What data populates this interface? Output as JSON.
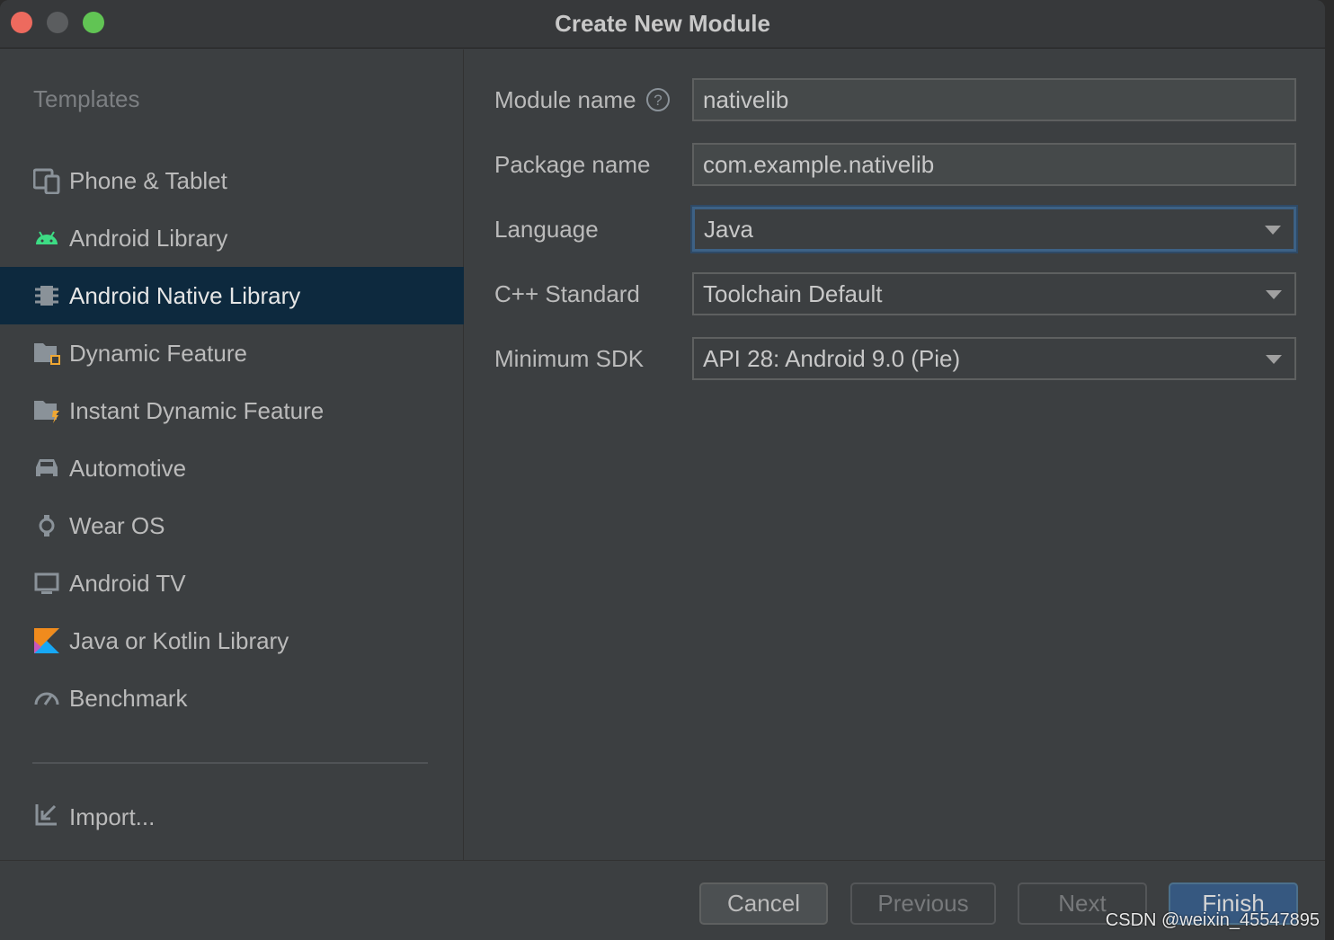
{
  "window": {
    "title": "Create New Module",
    "traffic_lights": [
      "#ed6a5e",
      "#5b5d5f",
      "#61c454"
    ]
  },
  "sidebar": {
    "heading": "Templates",
    "items": [
      {
        "label": "Phone & Tablet",
        "icon": "phone-tablet-icon"
      },
      {
        "label": "Android Library",
        "icon": "android-icon"
      },
      {
        "label": "Android Native Library",
        "icon": "chip-icon",
        "selected": true
      },
      {
        "label": "Dynamic Feature",
        "icon": "dynamic-feature-folder-icon"
      },
      {
        "label": "Instant Dynamic Feature",
        "icon": "instant-feature-folder-icon"
      },
      {
        "label": "Automotive",
        "icon": "car-icon"
      },
      {
        "label": "Wear OS",
        "icon": "watch-icon"
      },
      {
        "label": "Android TV",
        "icon": "tv-icon"
      },
      {
        "label": "Java or Kotlin Library",
        "icon": "kotlin-icon"
      },
      {
        "label": "Benchmark",
        "icon": "gauge-icon"
      }
    ],
    "import_label": "Import..."
  },
  "form": {
    "module_name": {
      "label": "Module name",
      "value": "nativelib"
    },
    "package_name": {
      "label": "Package name",
      "value": "com.example.nativelib"
    },
    "language": {
      "label": "Language",
      "value": "Java"
    },
    "cpp_standard": {
      "label": "C++ Standard",
      "value": "Toolchain Default"
    },
    "minimum_sdk": {
      "label": "Minimum SDK",
      "value": "API 28: Android 9.0 (Pie)"
    }
  },
  "footer": {
    "cancel": "Cancel",
    "previous": "Previous",
    "next": "Next",
    "finish": "Finish"
  },
  "watermark": "CSDN @weixin_45547895",
  "colors": {
    "accent": "#365880",
    "selection": "#0d293e"
  }
}
